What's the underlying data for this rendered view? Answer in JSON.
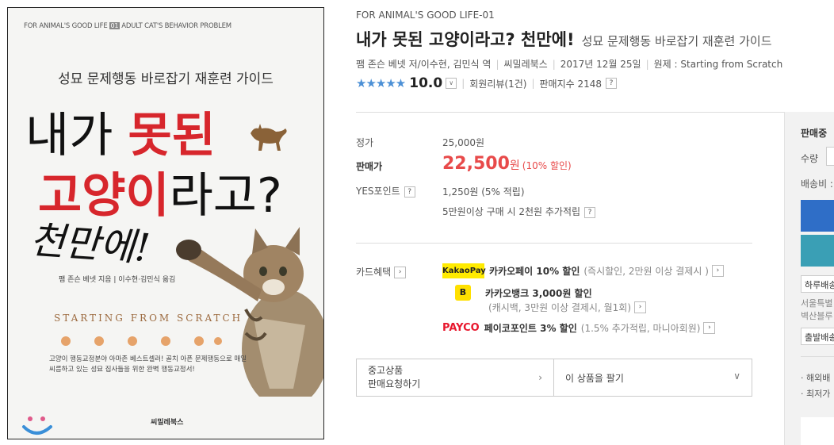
{
  "cover": {
    "series": "FOR ANIMAL'S GOOD LIFE",
    "series_num": "01",
    "series_name": "ADULT CAT'S BEHAVIOR PROBLEM",
    "subtitle": "성묘 문제행동 바로잡기 재훈련 가이드",
    "title_line1_a": "내가 ",
    "title_line1_b": "못된",
    "title_line2_a": "고양이",
    "title_line2_b": "라고?",
    "title_line3": "천만에!",
    "authors": "팸 존슨 베넷 지음 | 이수현·김민식 옮김",
    "english": "STARTING FROM SCRATCH",
    "blurb": "고양이 행동교정분야 아마존 베스트셀러! 골치 아픈 문제행동으로 매일 씨름하고 있는 성묘 집사들을 위한 완벽 행동교정서!",
    "publisher": "씨밀레북스"
  },
  "product": {
    "series_label": "FOR ANIMAL'S GOOD LIFE-01",
    "title": "내가 못된 고양이라고? 천만에!",
    "subtitle": "성묘 문제행동 바로잡기 재훈련 가이드",
    "authors": "팸 존슨 베넷 저/이수현, 김민식 역",
    "publisher": "씨밀레북스",
    "date": "2017년 12월 25일",
    "original": "원제 : Starting from Scratch",
    "stars": "★★★★★",
    "score": "10.0",
    "reviews": "회원리뷰(1건)",
    "sales_index": "판매지수 2148",
    "help_icon": "?",
    "dropdown_icon": "∨"
  },
  "price": {
    "list_label": "정가",
    "list_value": "25,000원",
    "sale_label": "판매가",
    "sale_value": "22,500",
    "sale_unit": "원",
    "discount": "(10% 할인)",
    "points_label": "YES포인트",
    "points_value": "1,250원 (5% 적립)",
    "points_extra": "5만원이상 구매 시 2천원 추가적립"
  },
  "card": {
    "label": "카드혜택",
    "kakaopay_logo": "KakaoPay",
    "kakaopay_title": "카카오페이 10% 할인",
    "kakaopay_note": "(즉시할인, 2만원 이상 결제시 )",
    "kbank_logo": "B",
    "kbank_title": "카카오뱅크 3,000원 할인",
    "kbank_note": "(캐시백, 3만원 이상 결제시, 월1회)",
    "payco_logo": "PAYCO",
    "payco_title": "페이코포인트 3% 할인",
    "payco_note": "(1.5% 추가적립, 마니아회원)"
  },
  "buttons": {
    "used_line1": "중고상품",
    "used_line2": "판매요청하기",
    "sell": "이 상품을 팔기",
    "arrow_right": "›",
    "arrow_down": "∨"
  },
  "panel": {
    "title": "판매중",
    "qty": "수량",
    "shipping": "배송비 :",
    "delivery_select": "하루배송",
    "address1": "서울특별",
    "address2": "벽산블루",
    "depart_select": "출발배송",
    "note1": "· 해외배",
    "note2": "· 최저가"
  },
  "colors": {
    "accent_blue": "#2f6ec7",
    "sale_red": "#e84a4a",
    "star_blue": "#4c90d6",
    "kakao_yellow": "#ffeb00",
    "payco_red": "#e8172d"
  }
}
